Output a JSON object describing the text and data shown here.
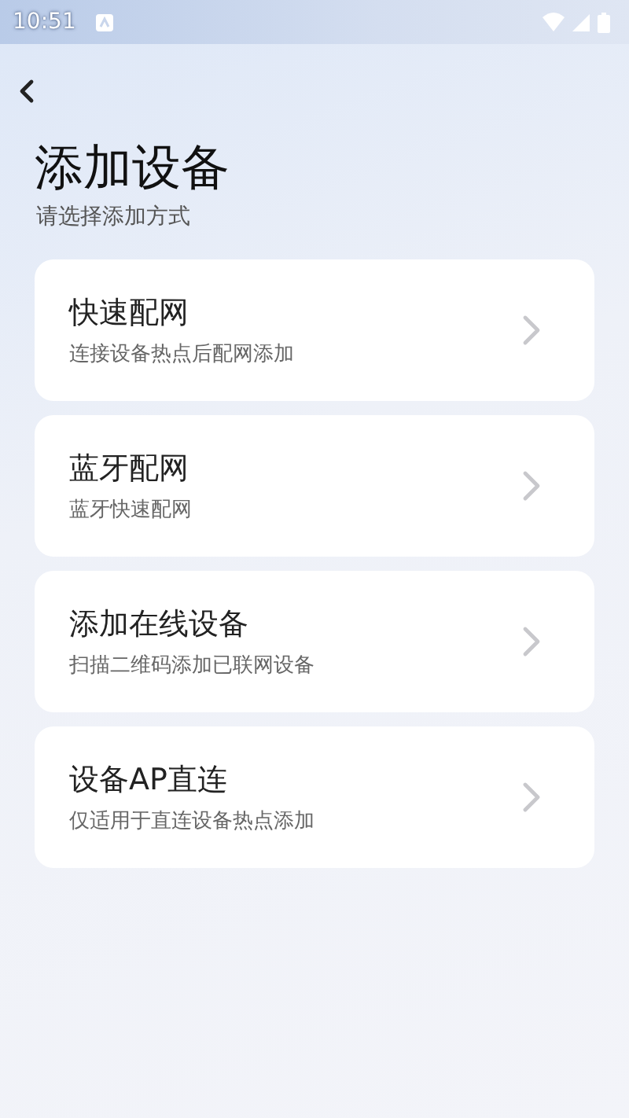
{
  "status_bar": {
    "time": "10:51"
  },
  "header": {
    "title": "添加设备",
    "subtitle": "请选择添加方式"
  },
  "options": [
    {
      "title": "快速配网",
      "description": "连接设备热点后配网添加"
    },
    {
      "title": "蓝牙配网",
      "description": "蓝牙快速配网"
    },
    {
      "title": "添加在线设备",
      "description": "扫描二维码添加已联网设备"
    },
    {
      "title": "设备AP直连",
      "description": "仅适用于直连设备热点添加"
    }
  ]
}
